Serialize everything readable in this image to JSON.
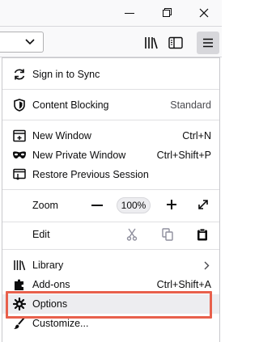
{
  "app_menu": {
    "sign_in": "Sign in to Sync",
    "content_blocking": "Content Blocking",
    "content_blocking_value": "Standard",
    "new_window": "New Window",
    "new_window_shortcut": "Ctrl+N",
    "new_private_window": "New Private Window",
    "new_private_window_shortcut": "Ctrl+Shift+P",
    "restore_session": "Restore Previous Session",
    "zoom_label": "Zoom",
    "zoom_level": "100%",
    "edit_label": "Edit",
    "library": "Library",
    "addons": "Add-ons",
    "addons_shortcut": "Ctrl+Shift+A",
    "options": "Options",
    "customize": "Customize..."
  },
  "colors": {
    "highlight_box": "#e8604c",
    "menu_button_active": "#d7d7db"
  },
  "icons": [
    "minimize-icon",
    "maximize-icon",
    "close-icon",
    "dropdown-chevron-icon",
    "library-icon",
    "sidebar-icon",
    "hamburger-menu-icon",
    "sync-icon",
    "shield-icon",
    "new-window-icon",
    "mask-icon",
    "restore-icon",
    "zoom-out-icon",
    "zoom-in-icon",
    "fullscreen-icon",
    "cut-icon",
    "copy-icon",
    "paste-icon",
    "library-menu-icon",
    "arrow-right-icon",
    "puzzle-icon",
    "gear-icon",
    "paintbrush-icon"
  ]
}
